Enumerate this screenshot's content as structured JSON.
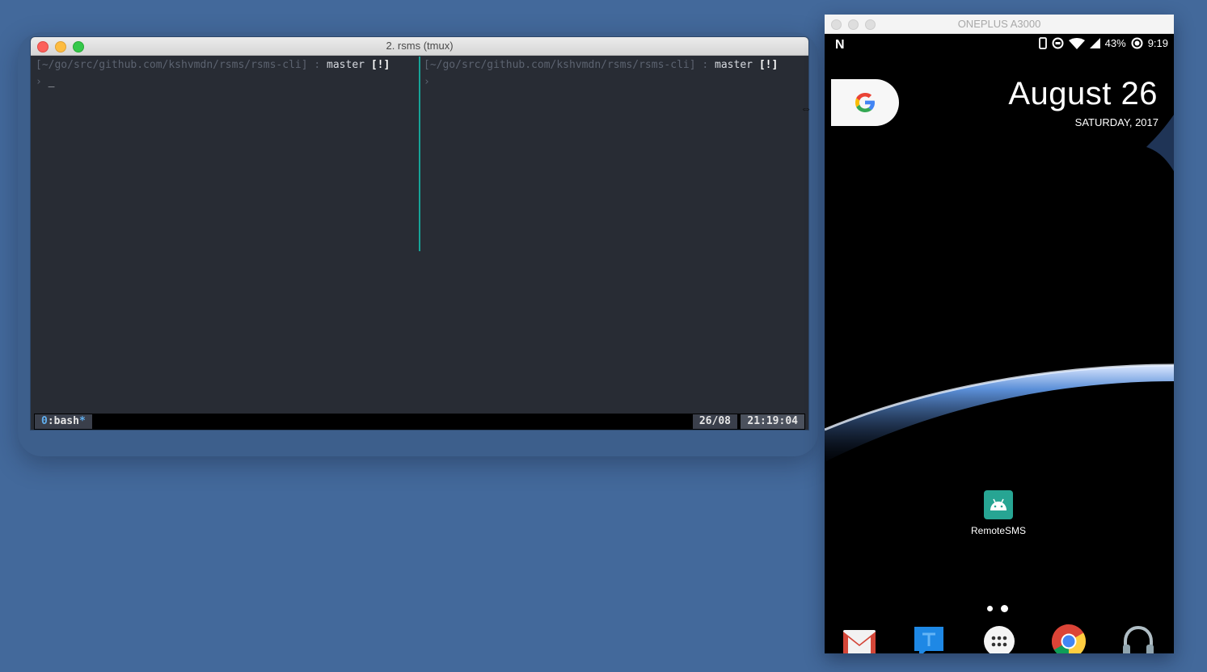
{
  "terminal": {
    "title": "2. rsms (tmux)",
    "left_pane": {
      "path": "[~/go/src/github.com/kshvmdn/rsms/rsms-cli]",
      "separator": " : ",
      "branch": "master",
      "flag": "[!]",
      "prompt": "›",
      "cursor": "_"
    },
    "right_pane": {
      "path": "[~/go/src/github.com/kshvmdn/rsms/rsms-cli]",
      "separator": " : ",
      "branch": "master",
      "flag": "[!]",
      "prompt": "›"
    },
    "status": {
      "window_index": "0",
      "window_sep": ":",
      "window_name": "bash",
      "window_flag": "*",
      "date": "26/08",
      "time": "21:19:04"
    }
  },
  "phone": {
    "window_title": "ONEPLUS A3000",
    "status_bar": {
      "notification_icon": "n-icon",
      "battery_percent": "43%",
      "clock": "9:19"
    },
    "date_widget": {
      "date": "August 26",
      "subline": "SATURDAY, 2017"
    },
    "app": {
      "label": "RemoteSMS",
      "icon": "android-icon"
    },
    "dock": [
      "gmail-icon",
      "messages-icon",
      "app-drawer-icon",
      "chrome-icon",
      "headphones-icon"
    ],
    "colors": {
      "app_tile": "#27a593",
      "tmux_border": "#17a398",
      "desktop": "#43699b"
    }
  }
}
